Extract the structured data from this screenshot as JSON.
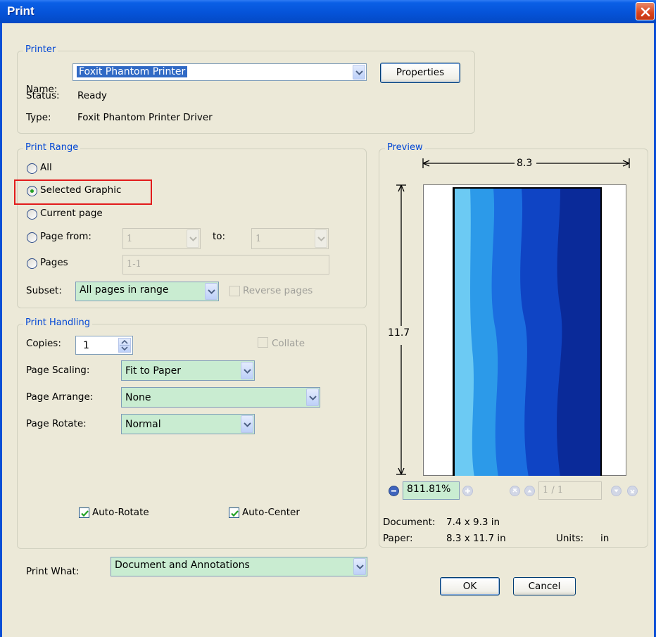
{
  "window": {
    "title": "Print",
    "accent": "#0553d8"
  },
  "printer": {
    "legend": "Printer",
    "name_label": "Name:",
    "name_value": "Foxit Phantom Printer",
    "properties_button": "Properties",
    "status_label": "Status:",
    "status_value": "Ready",
    "type_label": "Type:",
    "type_value": "Foxit Phantom Printer Driver"
  },
  "print_range": {
    "legend": "Print Range",
    "options": [
      {
        "label": "All",
        "checked": false
      },
      {
        "label": "Selected Graphic",
        "checked": true
      },
      {
        "label": "Current page",
        "checked": false
      },
      {
        "label": "Page from:",
        "checked": false
      },
      {
        "label": "Pages",
        "checked": false
      }
    ],
    "from_value": "1",
    "to_label": "to:",
    "to_value": "1",
    "pages_value": "1-1",
    "subset_label": "Subset:",
    "subset_value": "All pages in range",
    "reverse_label": "Reverse pages"
  },
  "print_handling": {
    "legend": "Print Handling",
    "copies_label": "Copies:",
    "copies_value": "1",
    "collate_label": "Collate",
    "page_scaling_label": "Page Scaling:",
    "page_scaling_value": "Fit to Paper",
    "page_arrange_label": "Page Arrange:",
    "page_arrange_value": "None",
    "page_rotate_label": "Page Rotate:",
    "page_rotate_value": "Normal",
    "auto_rotate_label": "Auto-Rotate",
    "auto_rotate_checked": true,
    "auto_center_label": "Auto-Center",
    "auto_center_checked": true
  },
  "print_what": {
    "label": "Print What:",
    "value": "Document and Annotations"
  },
  "preview": {
    "legend": "Preview",
    "width_label": "8.3",
    "height_label": "11.7",
    "zoom_value": "811.81%",
    "page_value": "1 / 1",
    "document_label": "Document:",
    "document_value": "7.4 x 9.3 in",
    "paper_label": "Paper:",
    "paper_value": "8.3 x 11.7 in",
    "units_label": "Units:",
    "units_value": "in"
  },
  "buttons": {
    "ok": "OK",
    "cancel": "Cancel"
  },
  "colors": {
    "legend_blue": "#0046d5",
    "field_green": "#c9ecd1",
    "highlight_red": "#e21b1b"
  }
}
